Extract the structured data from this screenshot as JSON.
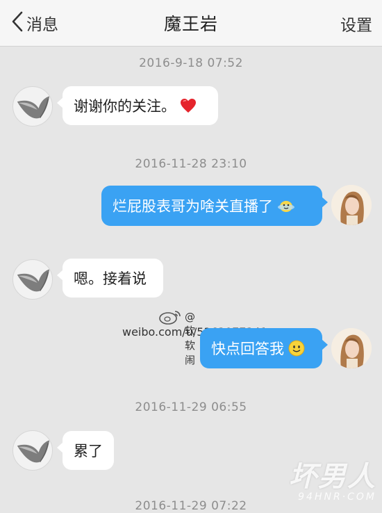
{
  "navbar": {
    "back_label": "消息",
    "title": "魔王岩",
    "settings_label": "设置"
  },
  "messages": [
    {
      "type": "timestamp",
      "text": "2016-9-18 07:52"
    },
    {
      "type": "incoming",
      "text": "谢谢你的关注。",
      "emoji": "heart-emoji"
    },
    {
      "type": "timestamp",
      "text": "2016-11-28 23:10"
    },
    {
      "type": "outgoing",
      "text": "烂屁股表哥为啥关直播了",
      "emoji": "sweat-smile-emoji"
    },
    {
      "type": "incoming",
      "text": "嗯。接着说"
    },
    {
      "type": "outgoing",
      "text": "快点回答我",
      "emoji": "smile-emoji"
    },
    {
      "type": "timestamp",
      "text": "2016-11-29 06:55"
    },
    {
      "type": "incoming",
      "text": "累了"
    },
    {
      "type": "timestamp",
      "text": "2016-11-29 07:22"
    }
  ],
  "watermark": {
    "handle": "@软软闹",
    "url": "weibo.com/u/5363077341"
  },
  "corner_watermark": {
    "main": "坏男人",
    "sub": "94HNR·COM"
  },
  "colors": {
    "outgoing_bubble": "#3aa2f3",
    "incoming_bubble": "#ffffff",
    "background": "#e6e6e6",
    "navbar": "#f6f6f6"
  }
}
